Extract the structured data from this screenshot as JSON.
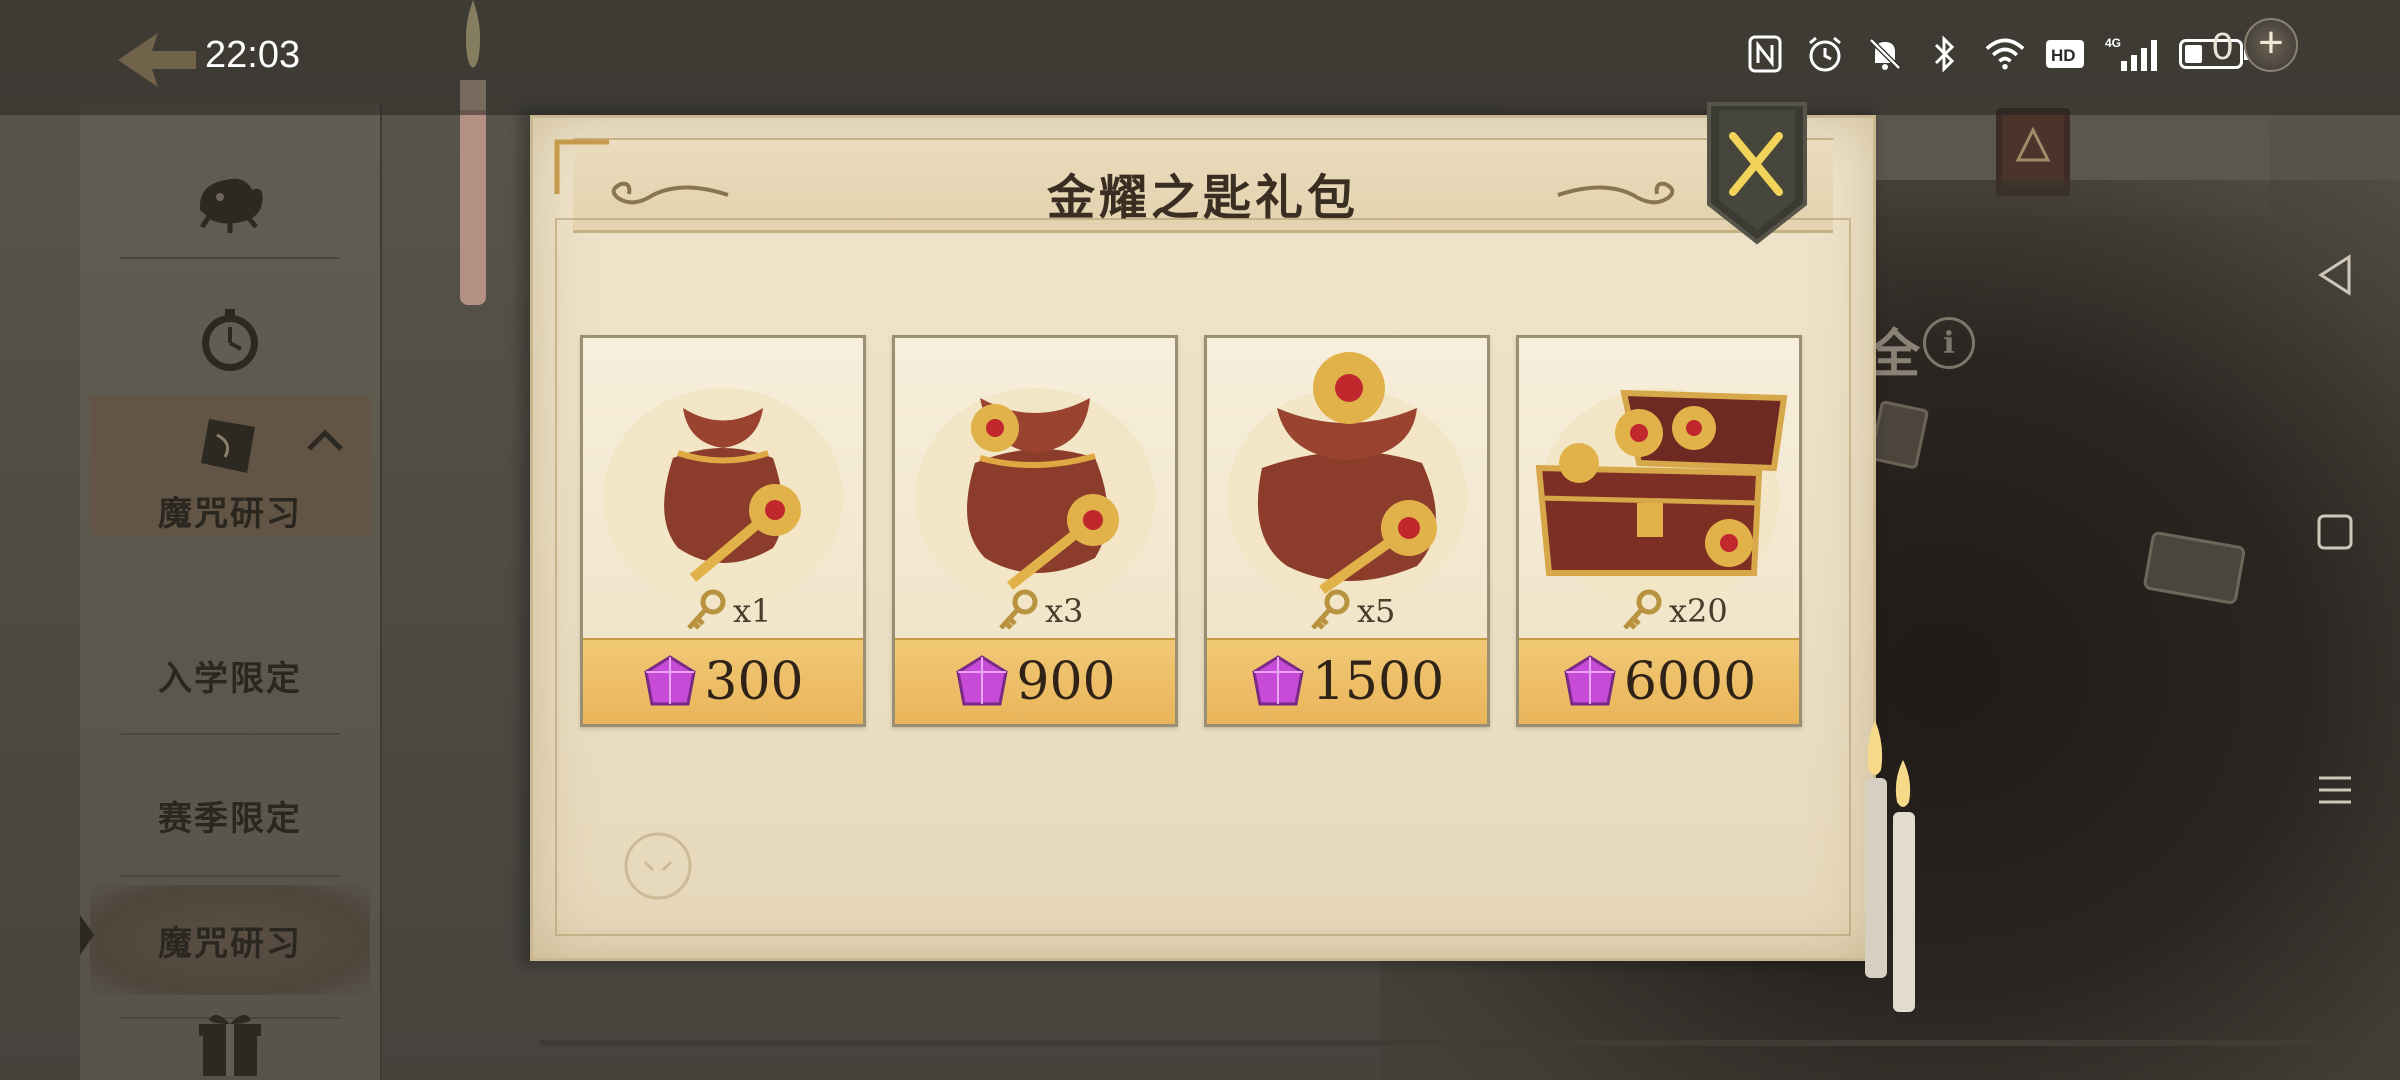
{
  "status_bar": {
    "time": "22:03",
    "currency_value": "0",
    "currency_add": "+",
    "battery_level": 0.3
  },
  "sidebar": {
    "items": [
      {
        "icon": "creature-icon"
      },
      {
        "icon": "pocket-watch-icon"
      },
      {
        "icon": "spell-card-icon",
        "label": "魔咒研习"
      },
      {
        "label": "入学限定"
      },
      {
        "label": "赛季限定"
      },
      {
        "label": "魔咒研习"
      },
      {
        "icon": "gift-box-icon"
      }
    ]
  },
  "background": {
    "partial_text": "全",
    "info_symbol": "i"
  },
  "modal": {
    "title": "金耀之匙礼包",
    "close_symbol": "X",
    "packs": [
      {
        "art": "small-bag-icon",
        "qty": "x1",
        "price": "300"
      },
      {
        "art": "medium-bag-icon",
        "qty": "x3",
        "price": "900"
      },
      {
        "art": "large-bag-icon",
        "qty": "x5",
        "price": "1500"
      },
      {
        "art": "treasure-chest-icon",
        "qty": "x20",
        "price": "6000"
      }
    ]
  },
  "colors": {
    "gem": "#c64bd6",
    "gold": "#e2b24a",
    "price_band": "#ecbd62",
    "parchment": "#ece0c5"
  }
}
